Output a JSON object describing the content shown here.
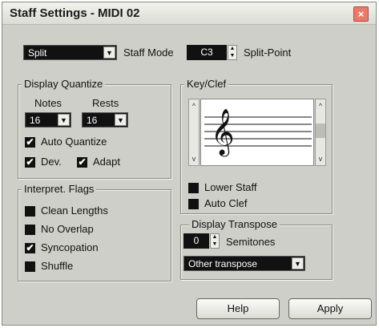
{
  "window": {
    "title": "Staff Settings - MIDI 02",
    "close_glyph": "×"
  },
  "top": {
    "mode_value": "Split",
    "staff_mode_label": "Staff Mode",
    "split_point_value": "C3",
    "split_point_label": "Split-Point"
  },
  "display_quantize": {
    "title": "Display Quantize",
    "notes_label": "Notes",
    "rests_label": "Rests",
    "notes_value": "16",
    "rests_value": "16",
    "auto_quantize_label": "Auto Quantize",
    "auto_quantize_checked": true,
    "dev_label": "Dev.",
    "dev_checked": true,
    "adapt_label": "Adapt",
    "adapt_checked": true
  },
  "interpret_flags": {
    "title": "Interpret. Flags",
    "items": [
      {
        "label": "Clean Lengths",
        "checked": false
      },
      {
        "label": "No Overlap",
        "checked": false
      },
      {
        "label": "Syncopation",
        "checked": true
      },
      {
        "label": "Shuffle",
        "checked": false
      }
    ]
  },
  "key_clef": {
    "title": "Key/Clef",
    "clef_glyph": "𝄞",
    "lower_staff_label": "Lower Staff",
    "lower_staff_checked": false,
    "auto_clef_label": "Auto Clef",
    "auto_clef_checked": false
  },
  "display_transpose": {
    "title": "Display Transpose",
    "semitones_value": "0",
    "semitones_label": "Semitones",
    "preset_value": "Other transpose"
  },
  "buttons": {
    "help": "Help",
    "apply": "Apply"
  },
  "icons": {
    "check": "✔",
    "arrow_down": "▼",
    "arrow_up": "▲",
    "scroll_up": "^",
    "scroll_down": "v"
  }
}
